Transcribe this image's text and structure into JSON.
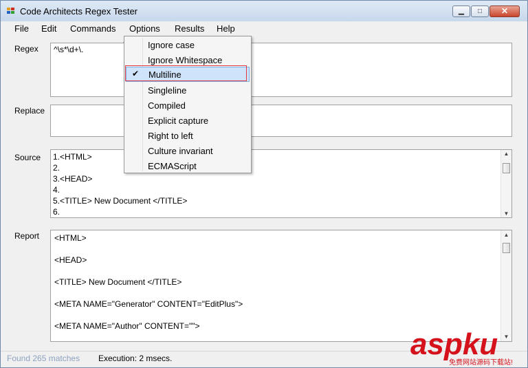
{
  "window": {
    "title": "Code Architects Regex Tester",
    "min_glyph": "▁",
    "max_glyph": "□",
    "close_glyph": "✕"
  },
  "menubar": {
    "items": [
      "File",
      "Edit",
      "Commands",
      "Options",
      "Results",
      "Help"
    ]
  },
  "labels": {
    "regex": "Regex",
    "replace": "Replace",
    "source": "Source",
    "report": "Report"
  },
  "regex": {
    "value": "^\\s*\\d+\\."
  },
  "replace": {
    "value": ""
  },
  "source": {
    "lines": [
      "1.<HTML>",
      "2.",
      "3.<HEAD>",
      "4.",
      "5.<TITLE> New Document </TITLE>",
      "6."
    ]
  },
  "report": {
    "lines": [
      "<HTML>",
      "",
      "<HEAD>",
      "",
      "<TITLE> New Document </TITLE>",
      "",
      "<META NAME=\"Generator\" CONTENT=\"EditPlus\">",
      "",
      "<META NAME=\"Author\" CONTENT=\"\">"
    ]
  },
  "options_menu": {
    "items": [
      "Ignore case",
      "Ignore Whitespace",
      "Multiline",
      "Singleline",
      "Compiled",
      "Explicit capture",
      "Right to left",
      "Culture invariant",
      "ECMAScript"
    ],
    "checked": "Multiline",
    "check_glyph": "✔"
  },
  "status": {
    "matches": "Found 265 matches",
    "execution": "Execution: 2 msecs."
  },
  "scroll": {
    "up": "▲",
    "down": "▼"
  },
  "watermark": {
    "text": "aspku",
    "sub": "免费网站源码下载站!"
  },
  "colors": {
    "highlight_border": "#e0383f",
    "checked_bg": "#cfe3fb",
    "watermark": "#d5121c"
  }
}
